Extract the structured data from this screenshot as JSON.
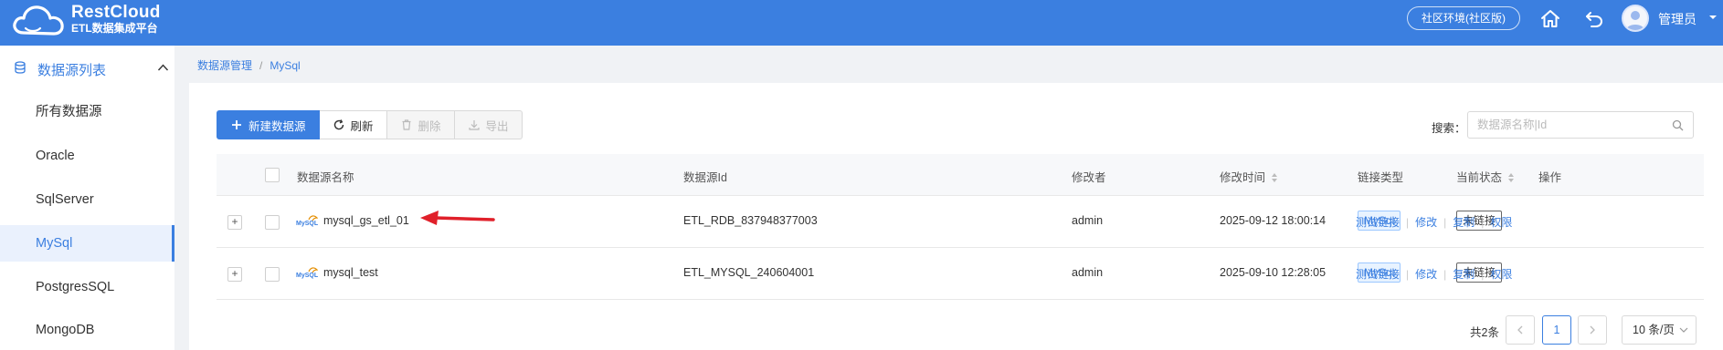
{
  "header": {
    "brand_name": "RestCloud",
    "brand_sub": "ETL数据集成平台",
    "env_label": "社区环境(社区版)",
    "user_name": "管理员",
    "accent": "#3b7fe0"
  },
  "sidebar": {
    "group_label": "数据源列表",
    "items": [
      {
        "label": "所有数据源"
      },
      {
        "label": "Oracle"
      },
      {
        "label": "SqlServer"
      },
      {
        "label": "MySql",
        "active": true
      },
      {
        "label": "PostgresSQL"
      },
      {
        "label": "MongoDB"
      }
    ]
  },
  "breadcrumb": {
    "root": "数据源管理",
    "sep": "/",
    "current": "MySql"
  },
  "toolbar": {
    "new_label": "新建数据源",
    "refresh_label": "刷新",
    "delete_label": "删除",
    "export_label": "导出"
  },
  "search": {
    "label": "搜索：",
    "placeholder": "数据源名称|Id"
  },
  "table": {
    "columns": [
      "数据源名称",
      "数据源Id",
      "修改者",
      "修改时间",
      "链接类型",
      "当前状态",
      "操作"
    ],
    "rows": [
      {
        "name": "mysql_gs_etl_01",
        "id": "ETL_RDB_837948377003",
        "modifier": "admin",
        "modified_time": "2025-09-12 18:00:14",
        "link_type": "MySql",
        "status": "未链接"
      },
      {
        "name": "mysql_test",
        "id": "ETL_MYSQL_240604001",
        "modifier": "admin",
        "modified_time": "2025-09-10 12:28:05",
        "link_type": "MySql",
        "status": "未链接"
      }
    ],
    "actions": [
      "测试链接",
      "修改",
      "复制",
      "权限"
    ],
    "expand_symbol": "+"
  },
  "pagination": {
    "total_label": "共2条",
    "current_page": "1",
    "page_size_label": "10 条/页"
  },
  "annotation": {
    "arrow_color": "#e0202a"
  }
}
